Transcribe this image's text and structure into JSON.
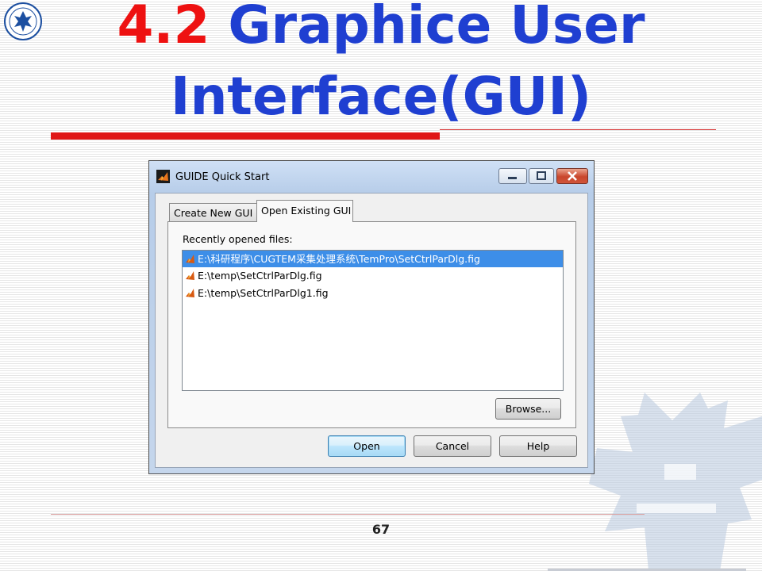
{
  "slide": {
    "title_number": "4.2",
    "title_line1_rest": "Graphice User",
    "title_line2": "Interface(GUI)",
    "page_number": "67"
  },
  "colors": {
    "title_blue": "#1f3fd1",
    "title_red": "#ee1111",
    "selection_blue": "#3d8ee8"
  },
  "dialog": {
    "title": "GUIDE Quick Start",
    "icons": {
      "app": "matlab-icon",
      "minimize": "minimize-icon",
      "maximize": "maximize-icon",
      "close": "close-icon"
    },
    "tabs": [
      {
        "label": "Create New GUI",
        "active": false
      },
      {
        "label": "Open Existing GUI",
        "active": true
      }
    ],
    "recent_label": "Recently opened files:",
    "files": [
      {
        "path": "E:\\科研程序\\CUGTEM采集处理系统\\TemPro\\SetCtrlParDlg.fig",
        "selected": true,
        "icon": "fig-file-icon"
      },
      {
        "path": "E:\\temp\\SetCtrlParDlg.fig",
        "selected": false,
        "icon": "fig-file-icon"
      },
      {
        "path": "E:\\temp\\SetCtrlParDlg1.fig",
        "selected": false,
        "icon": "fig-file-icon"
      }
    ],
    "buttons": {
      "browse": "Browse...",
      "open": "Open",
      "cancel": "Cancel",
      "help": "Help"
    }
  }
}
